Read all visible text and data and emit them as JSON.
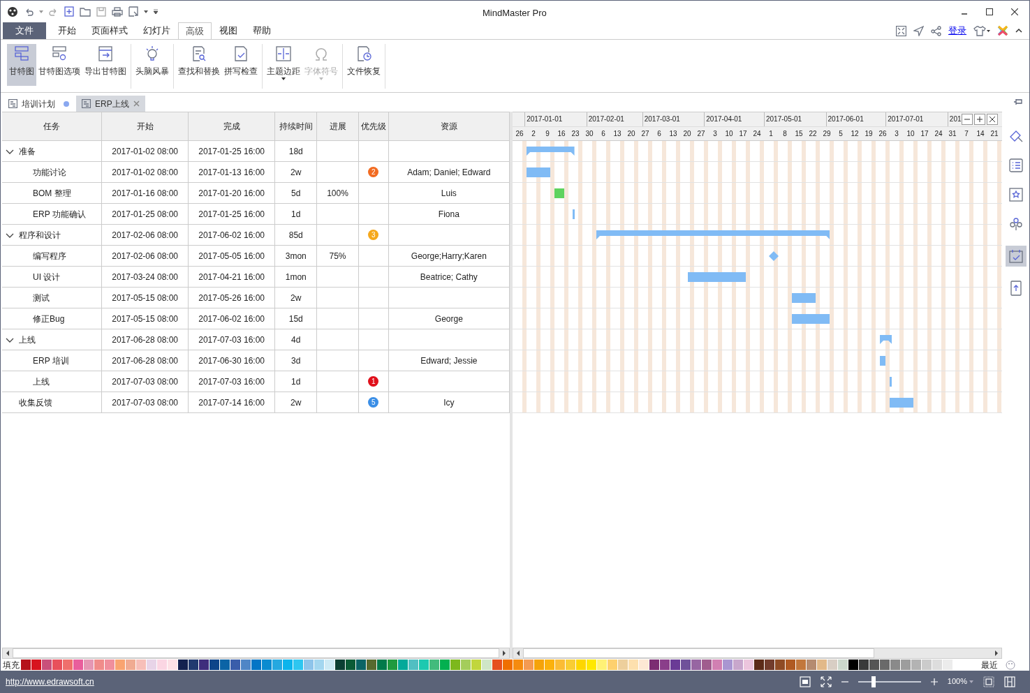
{
  "window": {
    "title": "MindMaster Pro"
  },
  "menu_tabs": [
    {
      "label": "文件",
      "kind": "file",
      "selected": false
    },
    {
      "label": "开始",
      "kind": "tab",
      "selected": false
    },
    {
      "label": "页面样式",
      "kind": "tab",
      "selected": false
    },
    {
      "label": "幻灯片",
      "kind": "tab",
      "selected": false
    },
    {
      "label": "高级",
      "kind": "tab",
      "selected": true
    },
    {
      "label": "视图",
      "kind": "tab",
      "selected": false
    },
    {
      "label": "帮助",
      "kind": "tab",
      "selected": false
    }
  ],
  "login_link": "登录",
  "ribbon_groups": [
    [
      {
        "label": "甘特图",
        "selected": true,
        "disabled": false,
        "dropdown": false
      },
      {
        "label": "甘特图选项",
        "selected": false,
        "disabled": false,
        "dropdown": false
      },
      {
        "label": "导出甘特图",
        "selected": false,
        "disabled": false,
        "dropdown": false
      }
    ],
    [
      {
        "label": "头脑风暴",
        "selected": false,
        "disabled": false,
        "dropdown": false
      }
    ],
    [
      {
        "label": "查找和替换",
        "selected": false,
        "disabled": false,
        "dropdown": false
      },
      {
        "label": "拼写检查",
        "selected": false,
        "disabled": false,
        "dropdown": false
      }
    ],
    [
      {
        "label": "主题边距",
        "selected": false,
        "disabled": false,
        "dropdown": true
      },
      {
        "label": "字体符号",
        "selected": false,
        "disabled": true,
        "dropdown": true
      }
    ],
    [
      {
        "label": "文件恢复",
        "selected": false,
        "disabled": false,
        "dropdown": false
      }
    ]
  ],
  "doc_tabs": [
    {
      "label": "培训计划",
      "selected": false,
      "modified": true
    },
    {
      "label": "ERP上线",
      "selected": true,
      "modified": false
    }
  ],
  "table": {
    "columns": [
      "任务",
      "开始",
      "完成",
      "持续时间",
      "进展",
      "优先级",
      "资源"
    ],
    "rows": [
      {
        "name": "准备",
        "start": "2017-01-02 08:00",
        "end": "2017-01-25 16:00",
        "duration": "18d",
        "bar": {
          "kind": "summary",
          "color": "#80bbf5"
        },
        "expanded": true,
        "children": [
          {
            "name": "功能讨论",
            "start": "2017-01-02 08:00",
            "end": "2017-01-13 16:00",
            "duration": "2w",
            "priority": {
              "text": "2",
              "color": "#f26b21"
            },
            "resources": "Adam; Daniel; Edward",
            "bar": {
              "kind": "task",
              "color": "#80bbf5"
            }
          },
          {
            "name": "BOM 整理",
            "start": "2017-01-16 08:00",
            "end": "2017-01-20 16:00",
            "duration": "5d",
            "progress": "100%",
            "resources": "Luis",
            "bar": {
              "kind": "task",
              "color": "#5fd35f"
            }
          },
          {
            "name": "ERP 功能确认",
            "start": "2017-01-25 08:00",
            "end": "2017-01-25 16:00",
            "duration": "1d",
            "resources": "Fiona",
            "bar": {
              "kind": "task",
              "color": "#80bbf5"
            }
          }
        ]
      },
      {
        "name": "程序和设计",
        "start": "2017-02-06 08:00",
        "end": "2017-06-02 16:00",
        "duration": "85d",
        "priority": {
          "text": "3",
          "color": "#f5a81c"
        },
        "bar": {
          "kind": "summary",
          "color": "#80bbf5"
        },
        "expanded": true,
        "children": [
          {
            "name": "编写程序",
            "start": "2017-02-06 08:00",
            "end": "2017-05-05 16:00",
            "duration": "3mon",
            "progress": "75%",
            "resources": "George;Harry;Karen",
            "bar": {
              "kind": "milestone",
              "color": "#80bbf5"
            }
          },
          {
            "name": "UI 设计",
            "start": "2017-03-24 08:00",
            "end": "2017-04-21 16:00",
            "duration": "1mon",
            "resources": "Beatrice; Cathy",
            "bar": {
              "kind": "task",
              "color": "#80bbf5"
            }
          },
          {
            "name": "测试",
            "start": "2017-05-15 08:00",
            "end": "2017-05-26 16:00",
            "duration": "2w",
            "bar": {
              "kind": "task",
              "color": "#80bbf5"
            }
          },
          {
            "name": "修正Bug",
            "start": "2017-05-15 08:00",
            "end": "2017-06-02 16:00",
            "duration": "15d",
            "resources": "George",
            "bar": {
              "kind": "task",
              "color": "#80bbf5"
            }
          }
        ]
      },
      {
        "name": "上线",
        "start": "2017-06-28 08:00",
        "end": "2017-07-03 16:00",
        "duration": "4d",
        "bar": {
          "kind": "summary",
          "color": "#80bbf5"
        },
        "expanded": true,
        "children": [
          {
            "name": "ERP 培训",
            "start": "2017-06-28 08:00",
            "end": "2017-06-30 16:00",
            "duration": "3d",
            "resources": "Edward; Jessie",
            "bar": {
              "kind": "task",
              "color": "#80bbf5"
            }
          },
          {
            "name": "上线",
            "start": "2017-07-03 08:00",
            "end": "2017-07-03 16:00",
            "duration": "1d",
            "priority": {
              "text": "1",
              "color": "#e0101b"
            },
            "bar": {
              "kind": "task",
              "color": "#80bbf5"
            }
          }
        ]
      },
      {
        "name": "收集反馈",
        "start": "2017-07-03 08:00",
        "end": "2017-07-14 16:00",
        "duration": "2w",
        "priority": {
          "text": "5",
          "color": "#3a8ee6"
        },
        "resources": "Icy",
        "bar": {
          "kind": "task",
          "color": "#80bbf5"
        }
      }
    ]
  },
  "gantt": {
    "months": [
      "2017-01-01",
      "2017-02-01",
      "2017-03-01",
      "2017-04-01",
      "2017-05-01",
      "2017-06-01",
      "2017-07-01",
      "201"
    ],
    "days": [
      "26",
      "2",
      "9",
      "16",
      "23",
      "30",
      "6",
      "13",
      "20",
      "27",
      "6",
      "13",
      "20",
      "27",
      "3",
      "10",
      "17",
      "24",
      "1",
      "8",
      "15",
      "22",
      "29",
      "5",
      "12",
      "19",
      "26",
      "3",
      "10",
      "17",
      "24",
      "31",
      "7",
      "14",
      "21"
    ]
  },
  "palette": {
    "label": "填充",
    "recent_label": "最近",
    "swatches": [
      {
        "color": "#b5121b"
      },
      {
        "color": "#d7141f"
      },
      {
        "color": "#c9507a"
      },
      {
        "color": "#e8505b"
      },
      {
        "color": "#ef6f6c"
      },
      {
        "color": "#e95e9c"
      },
      {
        "color": "#e597b4"
      },
      {
        "color": "#f08c8a"
      },
      {
        "color": "#f08f9c"
      },
      {
        "color": "#f9a470"
      },
      {
        "color": "#f0ab92"
      },
      {
        "color": "#f7bfb9"
      },
      {
        "color": "#e8d4e8"
      },
      {
        "color": "#fbd6e3"
      },
      {
        "color": "#fde1e6"
      },
      {
        "color": "#13214f"
      },
      {
        "color": "#213a6f"
      },
      {
        "color": "#3e2d7c"
      },
      {
        "color": "#0d4489"
      },
      {
        "color": "#0b64a6"
      },
      {
        "color": "#3a5daa"
      },
      {
        "color": "#4f86c6"
      },
      {
        "color": "#0475c6"
      },
      {
        "color": "#0b8bd0"
      },
      {
        "color": "#25a8e0"
      },
      {
        "color": "#0cb4ec"
      },
      {
        "color": "#2ec6f0"
      },
      {
        "color": "#8ec4ea"
      },
      {
        "color": "#a3d6ef"
      },
      {
        "color": "#cdeaf5"
      },
      {
        "color": "#0b3f33"
      },
      {
        "color": "#0b5b36"
      },
      {
        "color": "#0b6465"
      },
      {
        "color": "#576a2e"
      },
      {
        "color": "#027a4a"
      },
      {
        "color": "#1f9a3e"
      },
      {
        "color": "#04a99a"
      },
      {
        "color": "#51bfc2"
      },
      {
        "color": "#1cc9b0"
      },
      {
        "color": "#42bb7c"
      },
      {
        "color": "#03b050"
      },
      {
        "color": "#7db81c"
      },
      {
        "color": "#a4cd5b"
      },
      {
        "color": "#c1d63c"
      },
      {
        "color": "#cfe6c7"
      },
      {
        "color": "#e5501e"
      },
      {
        "color": "#ef6f00"
      },
      {
        "color": "#f58b0e"
      },
      {
        "color": "#f49a52"
      },
      {
        "color": "#f5a30a"
      },
      {
        "color": "#fbb10d"
      },
      {
        "color": "#fbbc35"
      },
      {
        "color": "#f9cd33"
      },
      {
        "color": "#fed600"
      },
      {
        "color": "#ffe800"
      },
      {
        "color": "#fff176"
      },
      {
        "color": "#fdd06e"
      },
      {
        "color": "#edcf9c"
      },
      {
        "color": "#fde0ae"
      },
      {
        "color": "#fde8d4"
      },
      {
        "color": "#7c2c72"
      },
      {
        "color": "#8a3e8a"
      },
      {
        "color": "#6a3b96"
      },
      {
        "color": "#6f519a"
      },
      {
        "color": "#9766a2"
      },
      {
        "color": "#a05d8e"
      },
      {
        "color": "#d180b2"
      },
      {
        "color": "#a996d1"
      },
      {
        "color": "#c8a7cc"
      },
      {
        "color": "#ecc5dd"
      },
      {
        "color": "#5c2b18"
      },
      {
        "color": "#723c2c"
      },
      {
        "color": "#8f4b24"
      },
      {
        "color": "#b05a22"
      },
      {
        "color": "#c2773c"
      },
      {
        "color": "#b58b70"
      },
      {
        "color": "#e2b989"
      },
      {
        "color": "#d8cec4"
      },
      {
        "color": "#ccd8cc"
      },
      {
        "color": "#000000"
      },
      {
        "color": "#3a3a3a"
      },
      {
        "color": "#555555"
      },
      {
        "color": "#6a6a6a"
      },
      {
        "color": "#8a8a8a"
      },
      {
        "color": "#9d9d9d"
      },
      {
        "color": "#b3b3b3"
      },
      {
        "color": "#cbcbcb"
      },
      {
        "color": "#dddddd"
      },
      {
        "color": "#ececec"
      }
    ]
  },
  "status_bar": {
    "link": "http://www.edrawsoft.cn",
    "zoom": "100%",
    "zoom_slider": {
      "level": 0.23
    }
  }
}
